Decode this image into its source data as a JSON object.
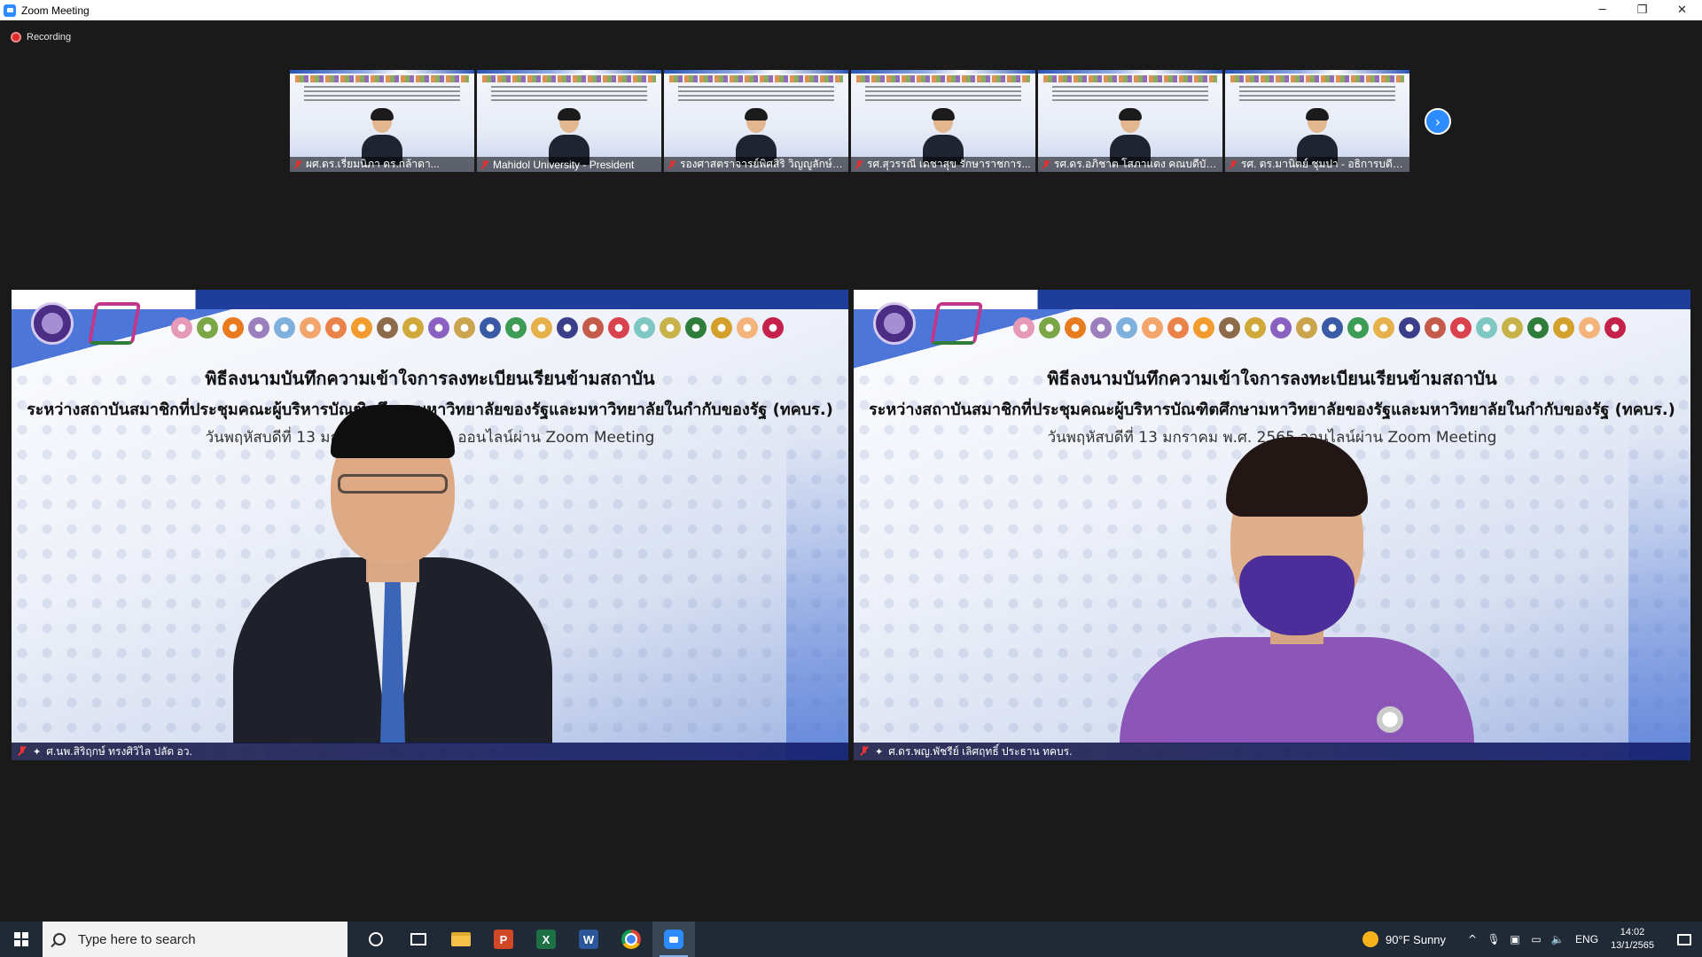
{
  "window": {
    "title": "Zoom Meeting",
    "minimize": "─",
    "restore": "❐",
    "close": "✕"
  },
  "recording": {
    "label": "Recording",
    "color": "#e02828"
  },
  "thumbnails": [
    {
      "name": "ผศ.ดร.เรี่ยมนิภา ดร.กล้าดา..."
    },
    {
      "name": "Mahidol University - President"
    },
    {
      "name": "รองศาสตราจารย์พิศสิริ วิญญูลักษ์ อ..."
    },
    {
      "name": "รศ.สุวรรณี เดชาสุข รักษาราชการ..."
    },
    {
      "name": "รศ.ดร.อภิชาต โสภาแดง คณบดีบัณ..."
    },
    {
      "name": "รศ. ดร.มานิตย์ ชุมปา - อธิการบดี ม..."
    }
  ],
  "next_arrow": "›",
  "slide": {
    "title": "พิธีลงนามบันทึกความเข้าใจการลงทะเบียนเรียนข้ามสถาบัน",
    "subtitle": "ระหว่างสถาบันสมาชิกที่ประชุมคณะผู้บริหารบัณฑิตศึกษามหาวิทยาลัยของรัฐและมหาวิทยาลัยในกำกับของรัฐ (ทคบร.)",
    "date": "วันพฤหัสบดีที่ 13 มกราคม พ.ศ. 2565  ออนไลน์ผ่าน Zoom Meeting"
  },
  "speakers": [
    {
      "name": "ศ.นพ.สิริฤกษ์ ทรงศิวิไล ปลัด อว.",
      "pin": "✦"
    },
    {
      "name": "ศ.ดร.พญ.พัชรีย์ เลิศฤทธิ์ ประธาน ทคบร.",
      "pin": "✦"
    }
  ],
  "emblem_colors": [
    "#e79ab8",
    "#7aa646",
    "#e87b1d",
    "#9b7fbc",
    "#7fb0dd",
    "#f3a56c",
    "#e9834a",
    "#f29b2e",
    "#8d6a4a",
    "#d1a83a",
    "#8a61c1",
    "#caa54e",
    "#3a5aa5",
    "#3c9b55",
    "#e6b14a",
    "#3b3f8a",
    "#c45a4a",
    "#d9434d",
    "#7fc7c2",
    "#c8b24a",
    "#2f7d3a",
    "#d4a02c",
    "#f4b37a",
    "#c4224a"
  ],
  "taskbar": {
    "search_placeholder": "Type here to search",
    "apps": [
      {
        "name": "cortana",
        "label": ""
      },
      {
        "name": "task-view",
        "label": ""
      },
      {
        "name": "file-explorer",
        "label": ""
      },
      {
        "name": "powerpoint",
        "label": "P",
        "color": "#d24726"
      },
      {
        "name": "excel",
        "label": "X",
        "color": "#1d7044"
      },
      {
        "name": "word",
        "label": "W",
        "color": "#2b579a"
      },
      {
        "name": "chrome",
        "label": ""
      },
      {
        "name": "zoom",
        "label": ""
      }
    ],
    "weather": "90°F  Sunny",
    "chevron": "^",
    "language": "ENG",
    "time": "14:02",
    "date": "13/1/2565"
  }
}
